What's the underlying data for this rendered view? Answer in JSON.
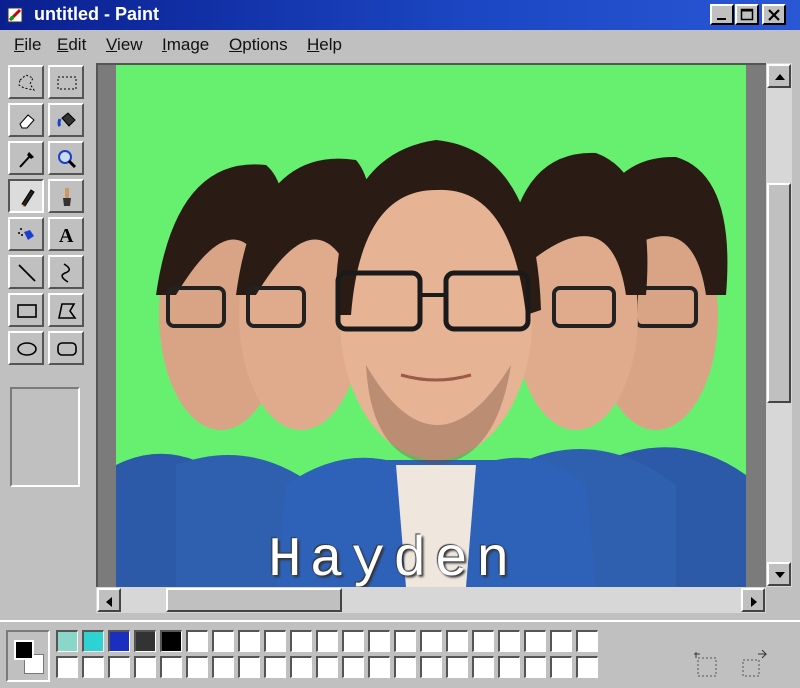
{
  "window": {
    "title": "untitled - Paint"
  },
  "title_buttons": [
    "minimize",
    "maximize",
    "close"
  ],
  "menu": {
    "items": [
      "File",
      "Edit",
      "View",
      "Image",
      "Options",
      "Help"
    ]
  },
  "tools": [
    {
      "icon": "free-form-select-icon"
    },
    {
      "icon": "rect-select-icon"
    },
    {
      "icon": "eraser-icon"
    },
    {
      "icon": "fill-bucket-icon"
    },
    {
      "icon": "color-picker-icon"
    },
    {
      "icon": "magnifier-icon"
    },
    {
      "icon": "pencil-icon",
      "active": true
    },
    {
      "icon": "brush-icon"
    },
    {
      "icon": "airbrush-icon"
    },
    {
      "icon": "text-icon",
      "glyph": "A"
    },
    {
      "icon": "line-icon"
    },
    {
      "icon": "curve-icon"
    },
    {
      "icon": "rectangle-icon"
    },
    {
      "icon": "polygon-icon"
    },
    {
      "icon": "ellipse-icon"
    },
    {
      "icon": "rounded-rect-icon"
    }
  ],
  "canvas": {
    "background_color": "#67f06f",
    "caption": "Hayden"
  },
  "colors": {
    "foreground": "#000000",
    "background": "#ffffff",
    "palette": [
      "#8ad6c8",
      "#2ed2d2",
      "#1a2fc0",
      "#333333",
      "#000000"
    ]
  },
  "status_icons": [
    "status-position-icon",
    "status-size-icon"
  ]
}
